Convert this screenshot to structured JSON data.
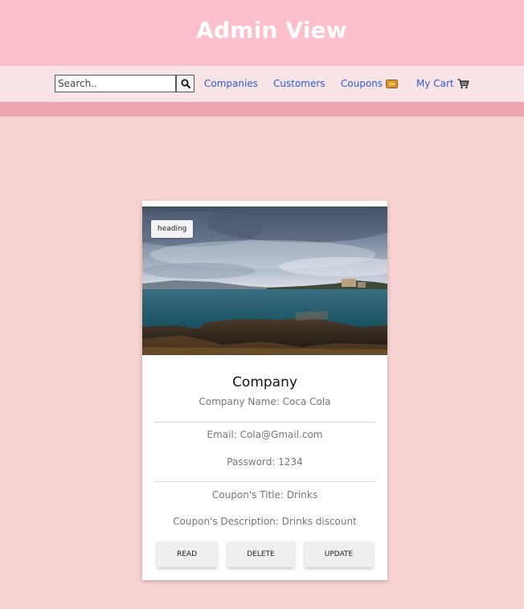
{
  "header": {
    "title": "Admin View"
  },
  "nav": {
    "search": {
      "placeholder": "Search.."
    },
    "links": [
      {
        "label": "Companies"
      },
      {
        "label": "Customers"
      },
      {
        "label": "Coupons"
      },
      {
        "label": "My Cart"
      }
    ]
  },
  "card": {
    "badge": "heading",
    "title": "Company",
    "company_name": "Company Name: Coca Cola",
    "email": "Email: Cola@Gmail.com",
    "password": "Password: 1234",
    "coupon_title": "Coupon's Title: Drinks",
    "coupon_description": "Coupon's Description: Drinks discount",
    "buttons": {
      "read": "READ",
      "delete": "DELETE",
      "update": "UPDATE"
    }
  },
  "colors": {
    "header_bg": "#fdbfcc",
    "nav_bg": "#f8e3e6",
    "stripe": "#eda4ae",
    "page_bg": "#f7d2d2",
    "link": "#2f5fd0"
  }
}
